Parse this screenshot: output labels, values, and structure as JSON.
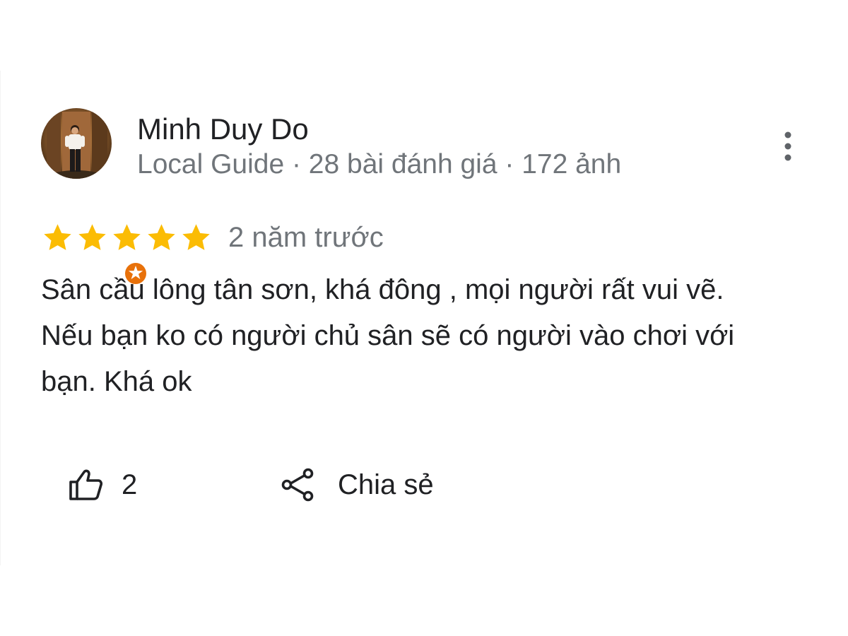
{
  "reviewer": {
    "name": "Minh Duy Do",
    "meta": "Local Guide · 28 bài đánh giá · 172 ảnh",
    "avatar_icon": "profile-photo",
    "badge_icon": "local-guide-star-badge",
    "badge_color": "#e8710a"
  },
  "review": {
    "rating": 5,
    "rating_max": 5,
    "star_color": "#fbbc04",
    "date": "2 năm trước",
    "text_lines": [
      "Sân cầu lông tân sơn, khá đông , mọi người rất vui vẽ.",
      "Nếu bạn ko có người chủ sân sẽ có người vào chơi với",
      "bạn. Khá ok"
    ]
  },
  "actions": {
    "like_icon": "thumbs-up-icon",
    "like_count": "2",
    "share_icon": "share-icon",
    "share_label": "Chia sẻ",
    "more_icon": "more-vertical-icon"
  },
  "colors": {
    "primary_text": "#202124",
    "secondary_text": "#70757a"
  }
}
